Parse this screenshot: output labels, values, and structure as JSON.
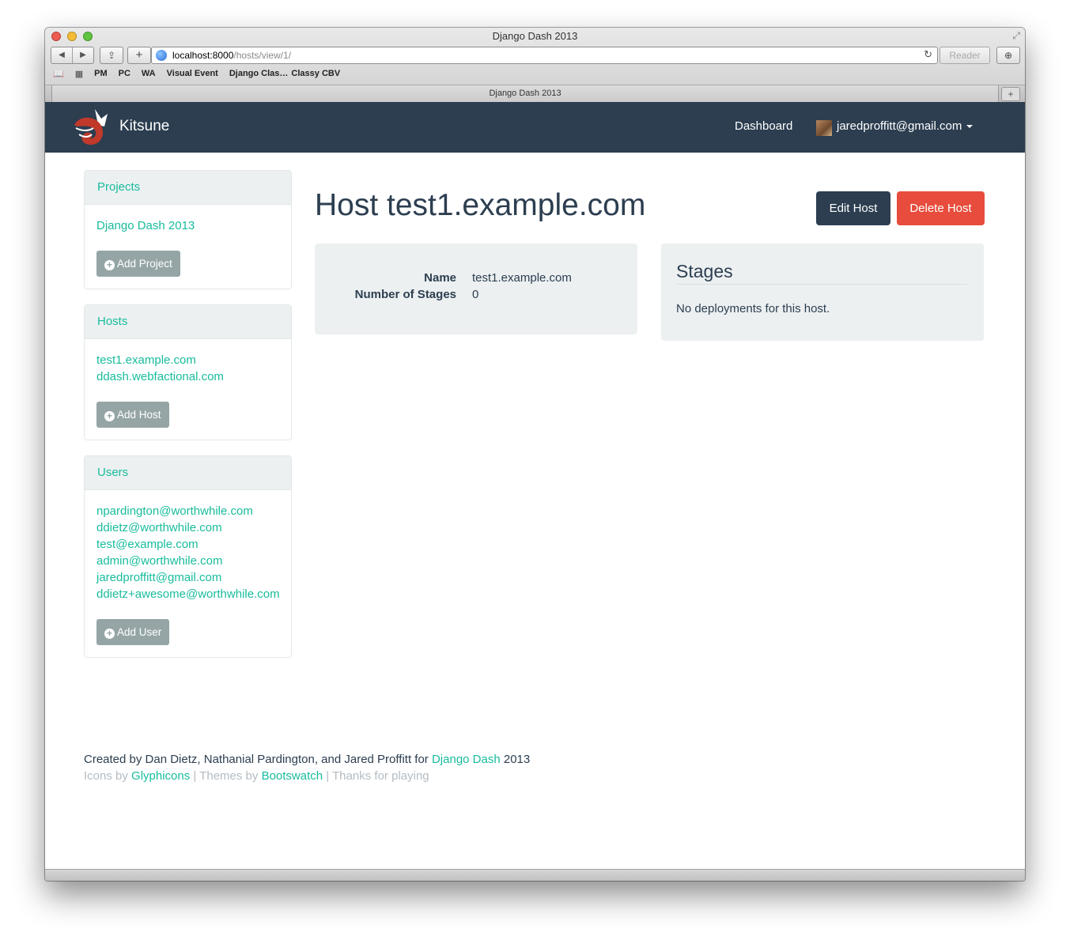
{
  "browser": {
    "window_title": "Django Dash 2013",
    "url_host": "localhost:8000",
    "url_path": "/hosts/view/1/",
    "reader_label": "Reader",
    "bookmarks": [
      "PM",
      "PC",
      "WA",
      "Visual Event",
      "Django Clas…",
      "Classy CBV"
    ],
    "tab_title": "Django Dash 2013"
  },
  "navbar": {
    "brand": "Kitsune",
    "dashboard": "Dashboard",
    "user_email": "jaredproffitt@gmail.com"
  },
  "sidebar": {
    "projects": {
      "title": "Projects",
      "items": [
        "Django Dash 2013"
      ],
      "add_label": "Add Project"
    },
    "hosts": {
      "title": "Hosts",
      "items": [
        "test1.example.com",
        "ddash.webfactional.com"
      ],
      "add_label": "Add Host"
    },
    "users": {
      "title": "Users",
      "items": [
        "npardington@worthwhile.com",
        "ddietz@worthwhile.com",
        "test@example.com",
        "admin@worthwhile.com",
        "jaredproffitt@gmail.com",
        "ddietz+awesome@worthwhile.com"
      ],
      "add_label": "Add User"
    }
  },
  "main": {
    "title": "Host test1.example.com",
    "edit_label": "Edit Host",
    "delete_label": "Delete Host",
    "details": [
      {
        "label": "Name",
        "value": "test1.example.com"
      },
      {
        "label": "Number of Stages",
        "value": "0"
      }
    ],
    "stages": {
      "title": "Stages",
      "empty_text": "No deployments for this host."
    }
  },
  "footer": {
    "line1_prefix": "Created by Dan Dietz, Nathanial Pardington, and Jared Proffitt for ",
    "line1_link": "Django Dash",
    "line1_suffix": " 2013",
    "icons_prefix": "Icons by ",
    "icons_link": "Glyphicons",
    "themes_prefix": " | Themes by ",
    "themes_link": "Bootswatch",
    "thanks": " | Thanks for playing"
  },
  "colors": {
    "navbar_bg": "#2c3e50",
    "accent": "#18bc9c",
    "danger": "#e74c3c",
    "well_bg": "#ecf0f1",
    "button_gray": "#95a5a6"
  }
}
